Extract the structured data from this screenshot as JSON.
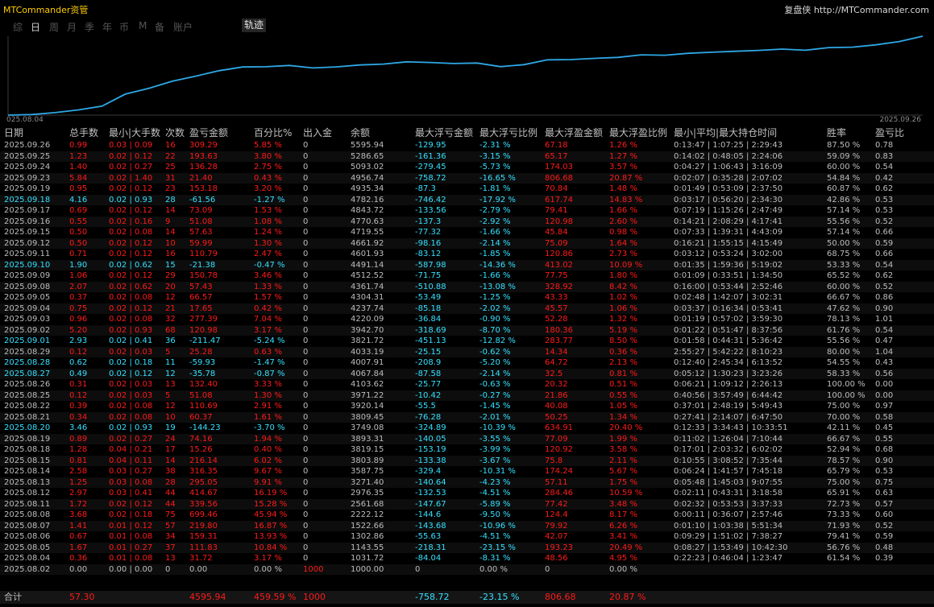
{
  "app_title": "MTCommander资管",
  "brand": "复盘侠 http://MTCommander.com",
  "periods": [
    "综",
    "日",
    "周",
    "月",
    "季",
    "年",
    "币",
    "M",
    "备",
    "账户"
  ],
  "active_period": "日",
  "trace_button": "轨迹",
  "chart_data": {
    "type": "line",
    "x_start_label": "025.08.04",
    "x_end_label": "2025.09.26",
    "x": [
      "2025.08.02",
      "2025.08.04",
      "2025.08.05",
      "2025.08.06",
      "2025.08.07",
      "2025.08.08",
      "2025.08.11",
      "2025.08.12",
      "2025.08.13",
      "2025.08.14",
      "2025.08.15",
      "2025.08.18",
      "2025.08.19",
      "2025.08.20",
      "2025.08.21",
      "2025.08.22",
      "2025.08.25",
      "2025.08.26",
      "2025.08.27",
      "2025.08.28",
      "2025.08.29",
      "2025.09.01",
      "2025.09.02",
      "2025.09.03",
      "2025.09.04",
      "2025.09.05",
      "2025.09.08",
      "2025.09.09",
      "2025.09.10",
      "2025.09.11",
      "2025.09.12",
      "2025.09.15",
      "2025.09.16",
      "2025.09.17",
      "2025.09.18",
      "2025.09.19",
      "2025.09.23",
      "2025.09.24",
      "2025.09.25",
      "2025.09.26"
    ],
    "values": [
      1000.0,
      1031.72,
      1143.55,
      1302.86,
      1522.66,
      2222.12,
      2561.68,
      2976.35,
      3271.4,
      3587.75,
      3803.89,
      3819.15,
      3893.31,
      3749.08,
      3809.45,
      3920.14,
      3971.22,
      4103.62,
      4067.84,
      4007.91,
      4033.19,
      3821.72,
      3942.7,
      4220.09,
      4237.74,
      4304.31,
      4361.74,
      4512.52,
      4491.14,
      4601.93,
      4661.92,
      4719.55,
      4770.63,
      4843.72,
      4782.16,
      4935.34,
      4956.74,
      5093.02,
      5286.65,
      5595.94
    ],
    "color": "#2fa8e6"
  },
  "table": {
    "headers": [
      "日期",
      "总手数",
      "最小|大手数",
      "次数",
      "盈亏金额",
      "百分比%",
      "出入金",
      "余额",
      "最大浮亏金额",
      "最大浮亏比例",
      "最大浮盈金额",
      "最大浮盈比例",
      "最小|平均|最大持仓时间",
      "胜率",
      "盈亏比"
    ],
    "rows": [
      [
        "2025.09.26",
        "0.99",
        "0.03 | 0.09",
        "16",
        "309.29",
        "5.85 %",
        "0",
        "5595.94",
        "-129.95",
        "-2.31 %",
        "67.18",
        "1.26 %",
        "0:13:47 | 1:07:25 | 2:29:43",
        "87.50 %",
        "0.78"
      ],
      [
        "2025.09.25",
        "1.23",
        "0.02 | 0.12",
        "22",
        "193.63",
        "3.80 %",
        "0",
        "5286.65",
        "-161.36",
        "-3.15 %",
        "65.17",
        "1.27 %",
        "0:14:02 | 0:48:05 | 2:24:06",
        "59.09 %",
        "0.83"
      ],
      [
        "2025.09.24",
        "1.40",
        "0.02 | 0.27",
        "25",
        "136.28",
        "2.75 %",
        "0",
        "5093.02",
        "-279.45",
        "-5.73 %",
        "174.03",
        "3.57 %",
        "0:04:27 | 1:06:43 | 3:16:09",
        "60.00 %",
        "0.54"
      ],
      [
        "2025.09.23",
        "5.84",
        "0.02 | 1.40",
        "31",
        "21.40",
        "0.43 %",
        "0",
        "4956.74",
        "-758.72",
        "-16.65 %",
        "806.68",
        "20.87 %",
        "0:02:07 | 0:35:28 | 2:07:02",
        "54.84 %",
        "0.42"
      ],
      [
        "2025.09.19",
        "0.95",
        "0.02 | 0.12",
        "23",
        "153.18",
        "3.20 %",
        "0",
        "4935.34",
        "-87.3",
        "-1.81 %",
        "70.84",
        "1.48 %",
        "0:01:49 | 0:53:09 | 2:37:50",
        "60.87 %",
        "0.62"
      ],
      [
        "2025.09.18",
        "4.16",
        "0.02 | 0.93",
        "28",
        "-61.56",
        "-1.27 %",
        "0",
        "4782.16",
        "-746.42",
        "-17.92 %",
        "617.74",
        "14.83 %",
        "0:03:17 | 0:56:20 | 2:34:30",
        "42.86 %",
        "0.53"
      ],
      [
        "2025.09.17",
        "0.69",
        "0.02 | 0.12",
        "14",
        "73.09",
        "1.53 %",
        "0",
        "4843.72",
        "-133.56",
        "-2.79 %",
        "79.41",
        "1.66 %",
        "0:07:19 | 1:15:26 | 2:47:49",
        "57.14 %",
        "0.53"
      ],
      [
        "2025.09.16",
        "0.55",
        "0.02 | 0.16",
        "9",
        "51.08",
        "1.08 %",
        "0",
        "4770.63",
        "-137.3",
        "-2.92 %",
        "120.98",
        "2.60 %",
        "0:14:21 | 2:08:29 | 4:17:41",
        "55.56 %",
        "0.52"
      ],
      [
        "2025.09.15",
        "0.50",
        "0.02 | 0.08",
        "14",
        "57.63",
        "1.24 %",
        "0",
        "4719.55",
        "-77.32",
        "-1.66 %",
        "45.84",
        "0.98 %",
        "0:07:33 | 1:39:31 | 4:43:09",
        "57.14 %",
        "0.66"
      ],
      [
        "2025.09.12",
        "0.50",
        "0.02 | 0.12",
        "10",
        "59.99",
        "1.30 %",
        "0",
        "4661.92",
        "-98.16",
        "-2.14 %",
        "75.09",
        "1.64 %",
        "0:16:21 | 1:55:15 | 4:15:49",
        "50.00 %",
        "0.59"
      ],
      [
        "2025.09.11",
        "0.71",
        "0.02 | 0.12",
        "16",
        "110.79",
        "2.47 %",
        "0",
        "4601.93",
        "-83.12",
        "-1.85 %",
        "120.86",
        "2.73 %",
        "0:03:12 | 0:53:24 | 3:02:00",
        "68.75 %",
        "0.66"
      ],
      [
        "2025.09.10",
        "1.90",
        "0.02 | 0.62",
        "15",
        "-21.38",
        "-0.47 %",
        "0",
        "4491.14",
        "-587.98",
        "-14.36 %",
        "413.02",
        "10.09 %",
        "0:01:35 | 1:59:36 | 5:19:02",
        "53.33 %",
        "0.54"
      ],
      [
        "2025.09.09",
        "1.06",
        "0.02 | 0.12",
        "29",
        "150.78",
        "3.46 %",
        "0",
        "4512.52",
        "-71.75",
        "-1.66 %",
        "77.75",
        "1.80 %",
        "0:01:09 | 0:33:51 | 1:34:50",
        "65.52 %",
        "0.62"
      ],
      [
        "2025.09.08",
        "2.07",
        "0.02 | 0.62",
        "20",
        "57.43",
        "1.33 %",
        "0",
        "4361.74",
        "-510.88",
        "-13.08 %",
        "328.92",
        "8.42 %",
        "0:16:00 | 0:53:44 | 2:52:46",
        "60.00 %",
        "0.52"
      ],
      [
        "2025.09.05",
        "0.37",
        "0.02 | 0.08",
        "12",
        "66.57",
        "1.57 %",
        "0",
        "4304.31",
        "-53.49",
        "-1.25 %",
        "43.33",
        "1.02 %",
        "0:02:48 | 1:42:07 | 3:02:31",
        "66.67 %",
        "0.86"
      ],
      [
        "2025.09.04",
        "0.75",
        "0.02 | 0.12",
        "21",
        "17.65",
        "0.42 %",
        "0",
        "4237.74",
        "-85.18",
        "-2.02 %",
        "45.57",
        "1.06 %",
        "0:03:37 | 0:16:34 | 0:53:41",
        "47.62 %",
        "0.90"
      ],
      [
        "2025.09.03",
        "0.96",
        "0.02 | 0.08",
        "32",
        "277.39",
        "7.04 %",
        "0",
        "4220.09",
        "-36.84",
        "-0.90 %",
        "52.28",
        "1.32 %",
        "0:01:19 | 0:57:02 | 3:59:30",
        "78.13 %",
        "1.01"
      ],
      [
        "2025.09.02",
        "5.20",
        "0.02 | 0.93",
        "68",
        "120.98",
        "3.17 %",
        "0",
        "3942.70",
        "-318.69",
        "-8.70 %",
        "180.36",
        "5.19 %",
        "0:01:22 | 0:51:47 | 8:37:56",
        "61.76 %",
        "0.54"
      ],
      [
        "2025.09.01",
        "2.93",
        "0.02 | 0.41",
        "36",
        "-211.47",
        "-5.24 %",
        "0",
        "3821.72",
        "-451.13",
        "-12.82 %",
        "283.77",
        "8.50 %",
        "0:01:58 | 0:44:31 | 5:36:42",
        "55.56 %",
        "0.47"
      ],
      [
        "2025.08.29",
        "0.12",
        "0.02 | 0.03",
        "5",
        "25.28",
        "0.63 %",
        "0",
        "4033.19",
        "-25.15",
        "-0.62 %",
        "14.34",
        "0.36 %",
        "2:55:27 | 5:42:22 | 8:10:23",
        "80.00 %",
        "1.04"
      ],
      [
        "2025.08.28",
        "0.62",
        "0.02 | 0.18",
        "11",
        "-59.93",
        "-1.47 %",
        "0",
        "4007.91",
        "-208.9",
        "-5.20 %",
        "64.72",
        "2.13 %",
        "0:12:40 | 2:45:34 | 6:13:52",
        "54.55 %",
        "0.43"
      ],
      [
        "2025.08.27",
        "0.49",
        "0.02 | 0.12",
        "12",
        "-35.78",
        "-0.87 %",
        "0",
        "4067.84",
        "-87.58",
        "-2.14 %",
        "32.5",
        "0.81 %",
        "0:05:12 | 1:30:23 | 3:23:26",
        "58.33 %",
        "0.56"
      ],
      [
        "2025.08.26",
        "0.31",
        "0.02 | 0.03",
        "13",
        "132.40",
        "3.33 %",
        "0",
        "4103.62",
        "-25.77",
        "-0.63 %",
        "20.32",
        "0.51 %",
        "0:06:21 | 1:09:12 | 2:26:13",
        "100.00 %",
        "0.00"
      ],
      [
        "2025.08.25",
        "0.12",
        "0.02 | 0.03",
        "5",
        "51.08",
        "1.30 %",
        "0",
        "3971.22",
        "-10.42",
        "-0.27 %",
        "21.86",
        "0.55 %",
        "0:40:56 | 3:57:49 | 6:44:42",
        "100.00 %",
        "0.00"
      ],
      [
        "2025.08.22",
        "0.39",
        "0.02 | 0.08",
        "12",
        "110.69",
        "2.91 %",
        "0",
        "3920.14",
        "-55.5",
        "-1.45 %",
        "40.08",
        "1.05 %",
        "0:37:01 | 2:48:19 | 5:49:43",
        "75.00 %",
        "0.97"
      ],
      [
        "2025.08.21",
        "0.34",
        "0.02 | 0.08",
        "10",
        "60.37",
        "1.61 %",
        "0",
        "3809.45",
        "-76.28",
        "-2.01 %",
        "50.25",
        "1.34 %",
        "0:27:41 | 2:14:07 | 6:47:50",
        "70.00 %",
        "0.58"
      ],
      [
        "2025.08.20",
        "3.46",
        "0.02 | 0.93",
        "19",
        "-144.23",
        "-3.70 %",
        "0",
        "3749.08",
        "-324.89",
        "-10.39 %",
        "634.91",
        "20.40 %",
        "0:12:33 | 3:34:43 | 10:33:51",
        "42.11 %",
        "0.45"
      ],
      [
        "2025.08.19",
        "0.89",
        "0.02 | 0.27",
        "24",
        "74.16",
        "1.94 %",
        "0",
        "3893.31",
        "-140.05",
        "-3.55 %",
        "77.09",
        "1.99 %",
        "0:11:02 | 1:26:04 | 7:10:44",
        "66.67 %",
        "0.55"
      ],
      [
        "2025.08.18",
        "1.28",
        "0.04 | 0.21",
        "17",
        "15.26",
        "0.40 %",
        "0",
        "3819.15",
        "-153.19",
        "-3.99 %",
        "120.92",
        "3.58 %",
        "0:17:01 | 2:03:32 | 6:02:02",
        "52.94 %",
        "0.68"
      ],
      [
        "2025.08.15",
        "0.81",
        "0.04 | 0.11",
        "14",
        "216.14",
        "6.02 %",
        "0",
        "3803.89",
        "-133.38",
        "-3.67 %",
        "75.8",
        "2.11 %",
        "0:10:55 | 3:08:52 | 7:35:44",
        "78.57 %",
        "0.90"
      ],
      [
        "2025.08.14",
        "2.58",
        "0.03 | 0.27",
        "38",
        "316.35",
        "9.67 %",
        "0",
        "3587.75",
        "-329.4",
        "-10.31 %",
        "174.24",
        "5.67 %",
        "0:06:24 | 1:41:57 | 7:45:18",
        "65.79 %",
        "0.53"
      ],
      [
        "2025.08.13",
        "1.25",
        "0.03 | 0.08",
        "28",
        "295.05",
        "9.91 %",
        "0",
        "3271.40",
        "-140.64",
        "-4.23 %",
        "57.11",
        "1.75 %",
        "0:05:48 | 1:45:03 | 9:07:55",
        "75.00 %",
        "0.75"
      ],
      [
        "2025.08.12",
        "2.97",
        "0.03 | 0.41",
        "44",
        "414.67",
        "16.19 %",
        "0",
        "2976.35",
        "-132.53",
        "-4.51 %",
        "284.46",
        "10.59 %",
        "0:02:11 | 0:43:31 | 3:18:58",
        "65.91 %",
        "0.63"
      ],
      [
        "2025.08.11",
        "1.72",
        "0.02 | 0.12",
        "44",
        "339.56",
        "15.28 %",
        "0",
        "2561.68",
        "-147.67",
        "-5.89 %",
        "77.42",
        "3.48 %",
        "0:02:32 | 0:53:53 | 3:37:33",
        "72.73 %",
        "0.57"
      ],
      [
        "2025.08.08",
        "3.68",
        "0.02 | 0.18",
        "75",
        "699.46",
        "45.94 %",
        "0",
        "2222.12",
        "-144.6",
        "-9.50 %",
        "124.4",
        "8.17 %",
        "0:00:11 | 0:36:07 | 2:57:46",
        "73.33 %",
        "0.60"
      ],
      [
        "2025.08.07",
        "1.41",
        "0.01 | 0.12",
        "57",
        "219.80",
        "16.87 %",
        "0",
        "1522.66",
        "-143.68",
        "-10.96 %",
        "79.92",
        "6.26 %",
        "0:01:10 | 1:03:38 | 5:51:34",
        "71.93 %",
        "0.52"
      ],
      [
        "2025.08.06",
        "0.67",
        "0.01 | 0.08",
        "34",
        "159.31",
        "13.93 %",
        "0",
        "1302.86",
        "-55.63",
        "-4.51 %",
        "42.07",
        "3.41 %",
        "0:09:29 | 1:51:02 | 7:38:27",
        "79.41 %",
        "0.59"
      ],
      [
        "2025.08.05",
        "1.67",
        "0.01 | 0.27",
        "37",
        "111.83",
        "10.84 %",
        "0",
        "1143.55",
        "-218.31",
        "-23.15 %",
        "193.23",
        "20.49 %",
        "0:08:27 | 1:53:49 | 10:42:30",
        "56.76 %",
        "0.48"
      ],
      [
        "2025.08.04",
        "0.36",
        "0.01 | 0.08",
        "13",
        "31.72",
        "3.17 %",
        "0",
        "1031.72",
        "-84.04",
        "-8.31 %",
        "48.56",
        "4.95 %",
        "0:22:23 | 0:46:04 | 1:23:47",
        "61.54 %",
        "0.39"
      ],
      [
        "2025.08.02",
        "0.00",
        "0.00 | 0.00",
        "0",
        "0.00",
        "0.00 %",
        "1000",
        "1000.00",
        "0",
        "0.00 %",
        "0",
        "0.00 %",
        "",
        "",
        ""
      ]
    ],
    "total": {
      "label": "合计",
      "lots": "57.30",
      "pnl": "4595.94",
      "percent": "459.59 %",
      "deposit": "1000",
      "max_float_loss": "-758.72",
      "max_float_loss_pct": "-23.15 %",
      "max_float_profit": "806.68",
      "max_float_profit_pct": "20.87 %"
    }
  },
  "colors": {
    "profit": "#ff1a1a",
    "loss": "#35e1ff",
    "neutral": "#bdbdbd",
    "line": "#2fa8e6"
  }
}
